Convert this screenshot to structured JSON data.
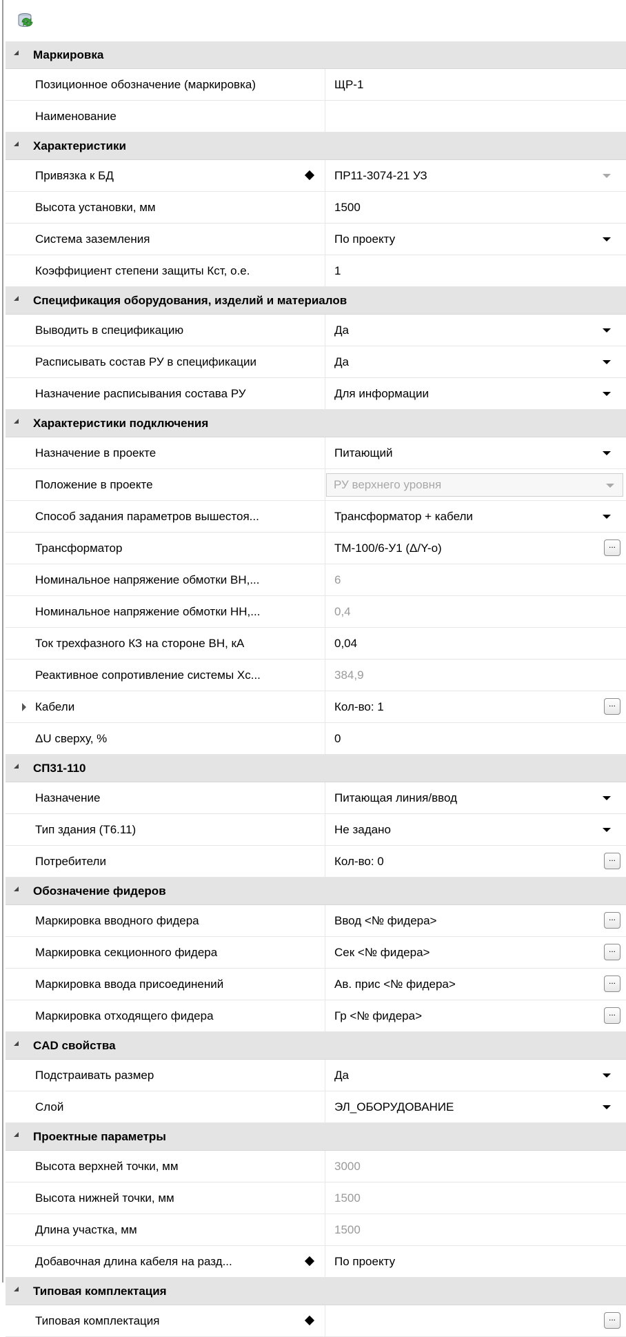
{
  "toolbar": {
    "refresh_icon": "refresh-database-icon"
  },
  "categories": {
    "marking": {
      "label": "Маркировка"
    },
    "characteristics": {
      "label": "Характеристики"
    },
    "spec": {
      "label": "Спецификация оборудования, изделий и материалов"
    },
    "connection": {
      "label": "Характеристики подключения"
    },
    "sp31": {
      "label": "СП31-110"
    },
    "feeders": {
      "label": "Обозначение фидеров"
    },
    "cad": {
      "label": "CAD свойства"
    },
    "project": {
      "label": "Проектные параметры"
    },
    "typical": {
      "label": "Типовая комплектация"
    }
  },
  "props": {
    "position_designation": {
      "name": "Позиционное обозначение (маркировка)",
      "value": "ЩР-1"
    },
    "naming": {
      "name": "Наименование",
      "value": ""
    },
    "db_link": {
      "name": "Привязка к БД",
      "value": "ПР11-3074-21 УЗ"
    },
    "install_height": {
      "name": "Высота установки, мм",
      "value": "1500"
    },
    "grounding_system": {
      "name": "Система заземления",
      "value": "По проекту"
    },
    "protection_coef": {
      "name": "Коэффициент степени защиты Кст, о.е.",
      "value": "1"
    },
    "output_to_spec": {
      "name": "Выводить в спецификацию",
      "value": "Да"
    },
    "describe_ru": {
      "name": "Расписывать состав РУ в спецификации",
      "value": "Да"
    },
    "ru_purpose": {
      "name": "Назначение расписывания состава РУ",
      "value": "Для информации"
    },
    "project_purpose": {
      "name": "Назначение в проекте",
      "value": "Питающий"
    },
    "project_position": {
      "name": "Положение в проекте",
      "value": "РУ верхнего уровня"
    },
    "upstream_params": {
      "name": "Способ задания параметров вышестоя...",
      "value": "Трансформатор + кабели"
    },
    "transformer": {
      "name": "Трансформатор",
      "value": "ТМ-100/6-У1 (Δ/Y-о)"
    },
    "hv_voltage": {
      "name": "Номинальное напряжение обмотки ВН,...",
      "value": "6"
    },
    "lv_voltage": {
      "name": "Номинальное напряжение обмотки НН,...",
      "value": "0,4"
    },
    "sc_current": {
      "name": "Ток трехфазного КЗ на стороне ВН, кА",
      "value": "0,04"
    },
    "reactance": {
      "name": "Реактивное сопротивление системы Хс...",
      "value": "384,9"
    },
    "cables": {
      "name": "Кабели",
      "value": "Кол-во: 1"
    },
    "delta_u": {
      "name": "ΔU сверху, %",
      "value": "0"
    },
    "purpose": {
      "name": "Назначение",
      "value": "Питающая линия/ввод"
    },
    "building_type": {
      "name": "Тип здания (Т6.11)",
      "value": "Не задано"
    },
    "consumers": {
      "name": "Потребители",
      "value": "Кол-во: 0"
    },
    "input_feeder": {
      "name": "Маркировка вводного фидера",
      "value": "Ввод <№ фидера>"
    },
    "section_feeder": {
      "name": "Маркировка секционного фидера",
      "value": "Сек <№ фидера>"
    },
    "connection_input": {
      "name": "Маркировка ввода присоединений",
      "value": "Ав. прис <№ фидера>"
    },
    "outgoing_feeder": {
      "name": "Маркировка отходящего фидера",
      "value": "Гр <№ фидера>"
    },
    "auto_size": {
      "name": "Подстраивать размер",
      "value": "Да"
    },
    "layer": {
      "name": "Слой",
      "value": "ЭЛ_ОБОРУДОВАНИЕ"
    },
    "top_height": {
      "name": "Высота верхней точки, мм",
      "value": "3000"
    },
    "bottom_height": {
      "name": "Высота нижней точки, мм",
      "value": "1500"
    },
    "section_length": {
      "name": "Длина участка, мм",
      "value": "1500"
    },
    "extra_cable_length": {
      "name": "Добавочная длина кабеля на разд...",
      "value": "По проекту"
    },
    "typical_set": {
      "name": "Типовая комплектация",
      "value": ""
    }
  }
}
